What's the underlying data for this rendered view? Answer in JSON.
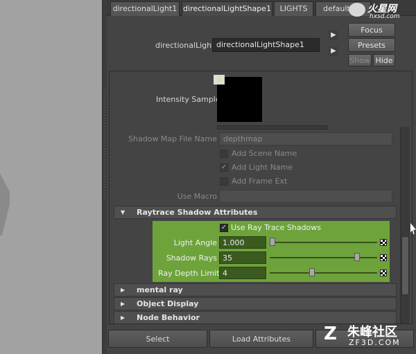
{
  "tabs": [
    {
      "label": "directionalLight1"
    },
    {
      "label": "directionalLightShape1"
    },
    {
      "label": "LIGHTS"
    },
    {
      "label": "defaultLig"
    }
  ],
  "header": {
    "node_label": "directionalLight:",
    "node_value": "directionalLightShape1",
    "focus_label": "Focus",
    "presets_label": "Presets",
    "show_label": "Show",
    "hide_label": "Hide"
  },
  "intensity_sample": {
    "label": "Intensity Sample"
  },
  "shadow_map": {
    "file_name_label": "Shadow Map File Name",
    "file_name_value": "depthmap",
    "add_scene_name": "Add Scene Name",
    "add_light_name": "Add Light Name",
    "add_frame_ext": "Add Frame Ext",
    "use_macro_label": "Use Macro"
  },
  "raytrace": {
    "section_label": "Raytrace Shadow Attributes",
    "use_ray_trace_label": "Use Ray Trace Shadows",
    "light_angle_label": "Light Angle",
    "light_angle_value": "1.000",
    "shadow_rays_label": "Shadow Rays",
    "shadow_rays_value": "35",
    "ray_depth_label": "Ray Depth Limit",
    "ray_depth_value": "4"
  },
  "sections": [
    {
      "label": "mental ray"
    },
    {
      "label": "Object Display"
    },
    {
      "label": "Node Behavior"
    }
  ],
  "bottom": {
    "select_label": "Select",
    "load_label": "Load Attributes"
  },
  "watermarks": {
    "top_title": "火星网",
    "top_url": "hxsd.com",
    "bottom_title": "朱峰社区",
    "bottom_url": "ZF3D.COM"
  }
}
